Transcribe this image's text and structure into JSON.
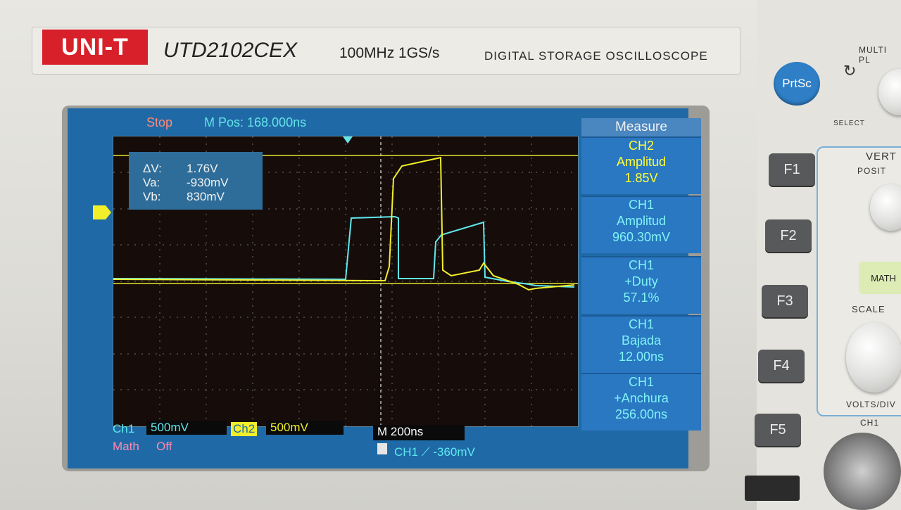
{
  "brand": {
    "logo": "UNI-T",
    "model": "UTD2102CEX",
    "spec": "100MHz  1GS/s",
    "description": "DIGITAL STORAGE OSCILLOSCOPE"
  },
  "status": {
    "run_state": "Stop",
    "m_pos": "M Pos: 168.000ns"
  },
  "cursors": {
    "delta_label": "ΔV:",
    "delta_value": "1.76V",
    "va_label": "Va:",
    "va_value": "-930mV",
    "vb_label": "Vb:",
    "vb_value": "830mV"
  },
  "measure": {
    "title": "Measure",
    "items": [
      {
        "channel": "CH2",
        "name": "Amplitud",
        "value": "1.85V"
      },
      {
        "channel": "CH1",
        "name": "Amplitud",
        "value": "960.30mV"
      },
      {
        "channel": "CH1",
        "name": "+Duty",
        "value": "57.1%"
      },
      {
        "channel": "CH1",
        "name": "Bajada",
        "value": "12.00ns"
      },
      {
        "channel": "CH1",
        "name": "+Anchura",
        "value": "256.00ns"
      }
    ]
  },
  "bottom": {
    "ch1_label": "Ch1",
    "ch1_scale": "500mV",
    "ch2_label": "Ch2",
    "ch2_scale": "500mV",
    "timebase": "M 200ns",
    "math_label": "Math",
    "math_state": "Off",
    "trigger": "CH1  ⟋  -360mV"
  },
  "buttons": {
    "prtsc": "PrtSc",
    "f1": "F1",
    "f2": "F2",
    "f3": "F3",
    "f4": "F4",
    "f5": "F5",
    "math": "MATH"
  },
  "panel_labels": {
    "multi": "MULTI PL",
    "select": "SELECT",
    "vertical": "VERT",
    "position": "POSIT",
    "scale": "SCALE",
    "volts_div": "VOLTS/DIV",
    "ch1": "CH1"
  },
  "colors": {
    "ch1": "#5fe8ee",
    "ch2": "#f2ee2a",
    "screen_bg": "#1f6aa6",
    "plot_bg": "#160d0a"
  }
}
